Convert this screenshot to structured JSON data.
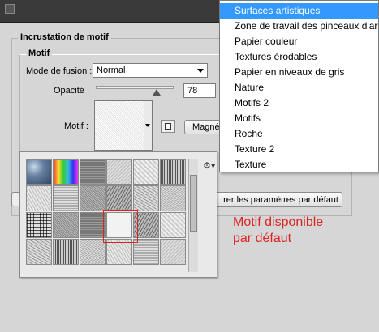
{
  "section": {
    "title": "Incrustation de motif",
    "subtitle": "Motif"
  },
  "blend": {
    "label": "Mode de fusion :",
    "value": "Normal"
  },
  "opacity": {
    "label": "Opacité :",
    "value": "78",
    "slider_fraction": 0.78
  },
  "pattern": {
    "label": "Motif :",
    "button_label": "Magnétisme"
  },
  "reset_button": "rer les paramètres par défaut",
  "annotation": [
    "Motif disponible",
    "par défaut"
  ],
  "menu": {
    "items": [
      "Surfaces artistiques",
      "Zone de travail des pinceaux d'artiste",
      "Papier couleur",
      "Textures érodables",
      "Papier en niveaux de gris",
      "Nature",
      "Motifs 2",
      "Motifs",
      "Roche",
      "Texture 2",
      "Texture"
    ],
    "selected_index": 0
  },
  "icons": {
    "settings": "gear-icon",
    "new_preset": "new-pattern-icon"
  }
}
